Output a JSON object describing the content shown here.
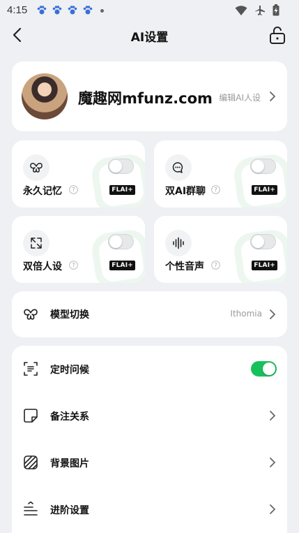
{
  "status_bar": {
    "time": "4:15"
  },
  "header": {
    "title": "AI设置"
  },
  "profile": {
    "name": "魔趣网mfunz.com",
    "edit_label": "编辑AI人设"
  },
  "features": [
    {
      "label": "永久记忆",
      "badge": "FLAI+",
      "enabled": false,
      "icon": "butterfly-icon"
    },
    {
      "label": "双AI群聊",
      "badge": "FLAI+",
      "enabled": false,
      "icon": "chat-bubbles-icon"
    },
    {
      "label": "双倍人设",
      "badge": "FLAI+",
      "enabled": false,
      "icon": "expand-icon"
    },
    {
      "label": "个性音声",
      "badge": "FLAI+",
      "enabled": false,
      "icon": "soundwave-icon"
    }
  ],
  "model": {
    "label": "模型切换",
    "value": "Ithomia"
  },
  "settings": [
    {
      "label": "定时问候",
      "type": "toggle",
      "enabled": true,
      "icon": "scan-greeting-icon"
    },
    {
      "label": "备注关系",
      "type": "link",
      "icon": "note-icon"
    },
    {
      "label": "背景图片",
      "type": "link",
      "icon": "striped-image-icon"
    },
    {
      "label": "进阶设置",
      "type": "link",
      "icon": "advanced-settings-icon"
    }
  ],
  "colors": {
    "accent_green": "#16c15a",
    "background": "#eef0f3",
    "card": "#ffffff"
  }
}
